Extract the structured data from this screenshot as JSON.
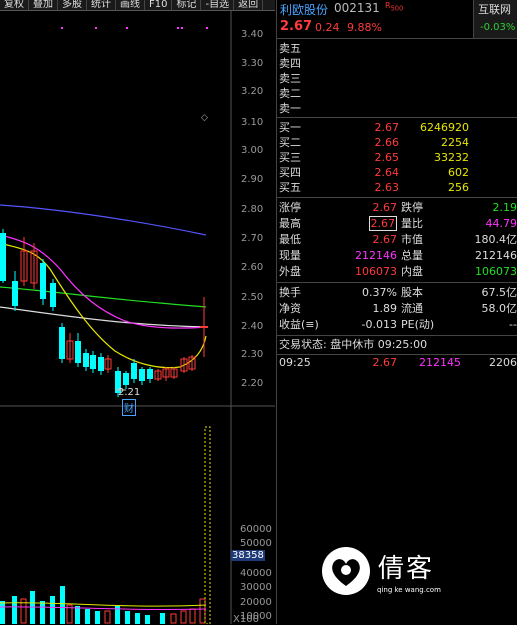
{
  "toolbar": [
    "复权",
    "叠加",
    "多股",
    "统计",
    "画线",
    "F10",
    "标记",
    "-自选",
    "返回"
  ],
  "stock": {
    "name": "利欧股份",
    "code": "002131",
    "r_badge": "R",
    "r_sub": "500",
    "price": "2.67",
    "change": "0.24",
    "pct": "9.88%"
  },
  "index": {
    "name": "互联网",
    "value": "-0.03%"
  },
  "ask": [
    {
      "label": "卖五",
      "price": "",
      "vol": ""
    },
    {
      "label": "卖四",
      "price": "",
      "vol": ""
    },
    {
      "label": "卖三",
      "price": "",
      "vol": ""
    },
    {
      "label": "卖二",
      "price": "",
      "vol": ""
    },
    {
      "label": "卖一",
      "price": "",
      "vol": ""
    }
  ],
  "bid": [
    {
      "label": "买一",
      "price": "2.67",
      "vol": "6246920"
    },
    {
      "label": "买二",
      "price": "2.66",
      "vol": "2254"
    },
    {
      "label": "买三",
      "price": "2.65",
      "vol": "33232"
    },
    {
      "label": "买四",
      "price": "2.64",
      "vol": "602"
    },
    {
      "label": "买五",
      "price": "2.63",
      "vol": "256"
    }
  ],
  "stats": {
    "zt_l": "涨停",
    "zt_v": "2.67",
    "dt_l": "跌停",
    "dt_v": "2.19",
    "high_l": "最高",
    "high_v": "2.67",
    "lb_l": "量比",
    "lb_v": "44.79",
    "low_l": "最低",
    "low_v": "2.67",
    "mv_l": "市值",
    "mv_v": "180.4亿",
    "xl_l": "现量",
    "xl_v": "212146",
    "zl_l": "总量",
    "zl_v": "212146",
    "wp_l": "外盘",
    "wp_v": "106073",
    "np_l": "内盘",
    "np_v": "106073",
    "hs_l": "换手",
    "hs_v": "0.37%",
    "gb_l": "股本",
    "gb_v": "67.5亿",
    "jz_l": "净资",
    "jz_v": "1.89",
    "lt_l": "流通",
    "lt_v": "58.0亿",
    "sy_l": "收益(≡)",
    "sy_v": "-0.013",
    "pe_l": "PE(动)",
    "pe_v": "--"
  },
  "status": "交易状态: 盘中休市 09:25:00",
  "tick": {
    "time": "09:25",
    "price": "2.67",
    "vol": "212145",
    "num": "2206"
  },
  "axis": {
    "price_ticks": [
      "3.40",
      "3.30",
      "3.20",
      "3.10",
      "3.00",
      "2.90",
      "2.80",
      "2.70",
      "2.60",
      "2.50",
      "2.40",
      "2.30",
      "2.20"
    ],
    "vol_ticks": [
      "60000",
      "50000",
      "40000",
      "30000",
      "20000",
      "10000"
    ],
    "vol_highlight": "38358",
    "vol_unit": "X100"
  },
  "annotations": {
    "low": "2.21",
    "event": "财"
  },
  "watermark": {
    "text": "倩客",
    "url": "qing ke wang.com"
  },
  "colors": {
    "up": "#ff3b3b",
    "down": "#00ffff",
    "bg": "#000000"
  }
}
